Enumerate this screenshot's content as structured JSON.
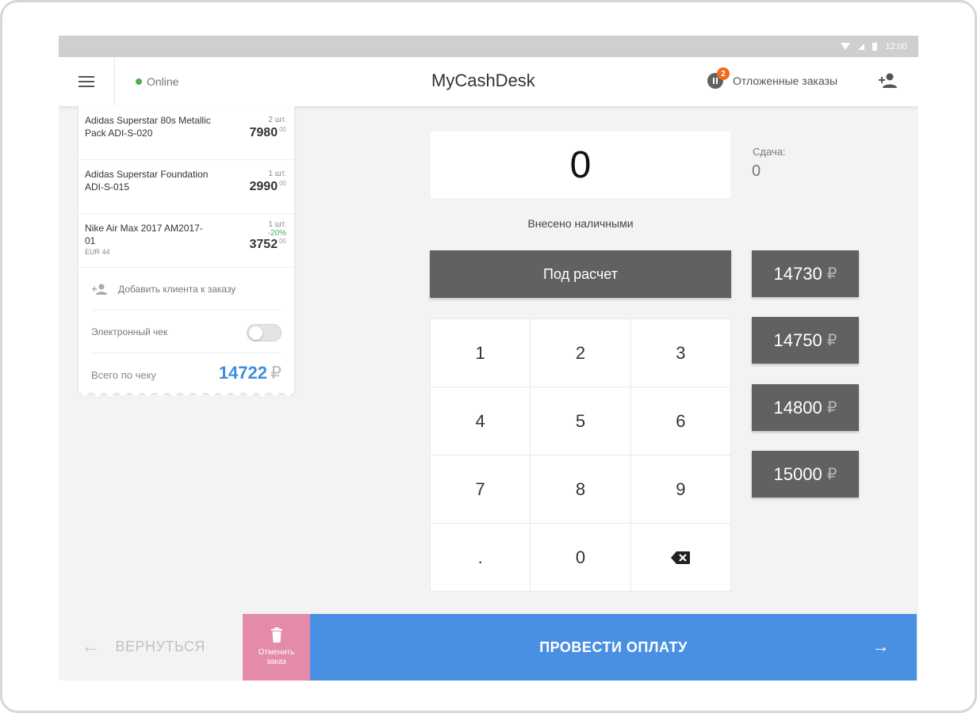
{
  "statusbar": {
    "time": "12:00"
  },
  "header": {
    "connection_status": "Online",
    "title": "MyCashDesk",
    "deferred_count": "2",
    "deferred_label": "Отложенные заказы"
  },
  "receipt": {
    "items": [
      {
        "name": "Adidas Superstar 80s Metallic Pack ADI-S-020",
        "sub": "",
        "qty": "2 шт.",
        "discount": "",
        "price": "7980",
        "cents": "00"
      },
      {
        "name": "Adidas Superstar Foundation ADI-S-015",
        "sub": "",
        "qty": "1 шт.",
        "discount": "",
        "price": "2990",
        "cents": "00"
      },
      {
        "name": "Nike Air Max 2017 AM2017-01",
        "sub": "EUR 44",
        "qty": "1 шт.",
        "discount": "-20%",
        "price": "3752",
        "cents": "00"
      }
    ],
    "add_client_label": "Добавить клиента к заказу",
    "e_receipt_label": "Электронный чек",
    "e_receipt_enabled": false,
    "total_label": "Всего по чеку",
    "total_value": "14722",
    "currency": "₽"
  },
  "payment": {
    "amount": "0",
    "change_label": "Сдача:",
    "change_value": "0",
    "cash_label": "Внесено наличными",
    "exact_button": "Под расчет",
    "keys": [
      "1",
      "2",
      "3",
      "4",
      "5",
      "6",
      "7",
      "8",
      "9",
      ".",
      "0"
    ],
    "quick_amounts": [
      "14730",
      "14750",
      "14800",
      "15000"
    ],
    "currency": "₽"
  },
  "footer": {
    "back_label": "ВЕРНУТЬСЯ",
    "cancel_label": "Отменить заказ",
    "pay_label": "ПРОВЕСТИ ОПЛАТУ"
  },
  "colors": {
    "primary": "#4a90e2",
    "dark_button": "#5f6163",
    "cancel": "#e48aaa",
    "online": "#4caf50",
    "badge": "#f26b1d",
    "total": "#3d8ee0"
  }
}
